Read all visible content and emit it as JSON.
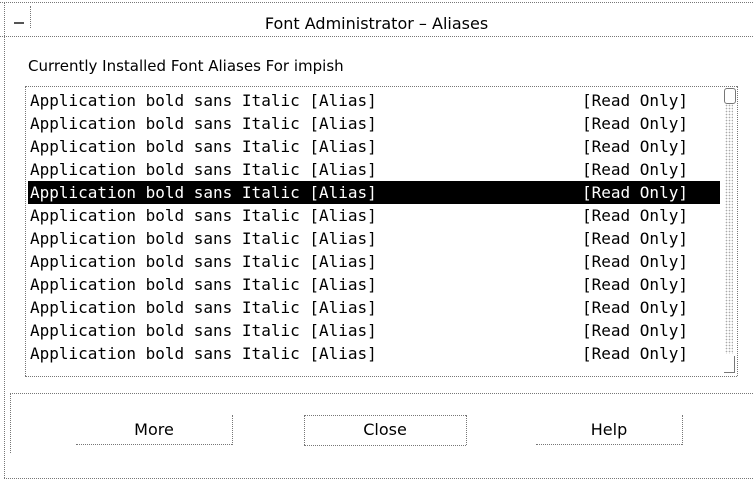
{
  "window": {
    "title": "Font Administrator – Aliases"
  },
  "list_label": "Currently Installed Font Aliases For impish",
  "fonts": [
    {
      "name": "Application bold sans Italic [Alias]",
      "status": "[Read Only]"
    },
    {
      "name": "Application bold sans Italic [Alias]",
      "status": "[Read Only]"
    },
    {
      "name": "Application bold sans Italic [Alias]",
      "status": "[Read Only]"
    },
    {
      "name": "Application bold sans Italic [Alias]",
      "status": "[Read Only]"
    },
    {
      "name": "Application bold sans Italic [Alias]",
      "status": "[Read Only]",
      "selected": true
    },
    {
      "name": "Application bold sans Italic [Alias]",
      "status": "[Read Only]"
    },
    {
      "name": "Application bold sans Italic [Alias]",
      "status": "[Read Only]"
    },
    {
      "name": "Application bold sans Italic [Alias]",
      "status": "[Read Only]"
    },
    {
      "name": "Application bold sans Italic [Alias]",
      "status": "[Read Only]"
    },
    {
      "name": "Application bold sans Italic [Alias]",
      "status": "[Read Only]"
    },
    {
      "name": "Application bold sans Italic [Alias]",
      "status": "[Read Only]"
    },
    {
      "name": "Application bold sans Italic [Alias]",
      "status": "[Read Only]"
    }
  ],
  "buttons": {
    "more": "More",
    "close": "Close",
    "help": "Help"
  },
  "colors": {
    "selection_bg": "#000000",
    "selection_fg": "#ffffff",
    "border": "#777777"
  },
  "icons": {
    "window_menu": "window-menu-icon"
  }
}
